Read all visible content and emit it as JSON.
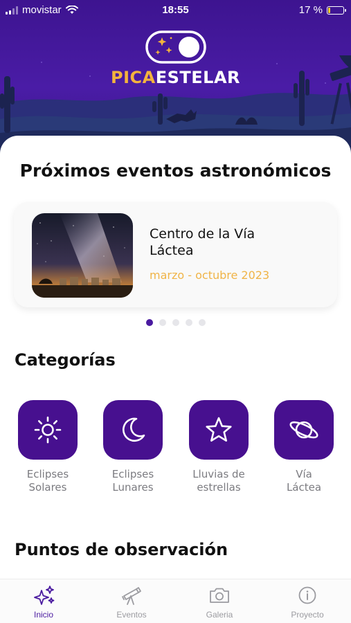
{
  "status_bar": {
    "carrier": "movistar",
    "time": "18:55",
    "battery_percent_text": "17 %",
    "battery_level": 0.17
  },
  "logo": {
    "part1": "PICA",
    "part2": "ESTELAR",
    "colors": {
      "part1": "#f3b33d",
      "part2": "#ffffff",
      "background": "#3d1490"
    }
  },
  "events_section": {
    "title": "Próximos eventos astronómicos",
    "cards": [
      {
        "name": "Centro de la Vía Láctea",
        "date": "marzo - octubre 2023",
        "image": "milky-way-photo"
      }
    ],
    "page_count": 5,
    "active_page": 0
  },
  "categories_section": {
    "title": "Categorías",
    "items": [
      {
        "label1": "Eclipses",
        "label2": "Solares",
        "icon": "sun-icon"
      },
      {
        "label1": "Eclipses",
        "label2": "Lunares",
        "icon": "moon-icon"
      },
      {
        "label1": "Lluvias de",
        "label2": "estrellas",
        "icon": "star-icon"
      },
      {
        "label1": "Vía",
        "label2": "Láctea",
        "icon": "planet-icon"
      }
    ],
    "tile_color": "#47108f"
  },
  "observation_section": {
    "title": "Puntos de observación"
  },
  "tabbar": {
    "tabs": [
      {
        "label": "Inicio",
        "icon": "sparkles-icon",
        "active": true
      },
      {
        "label": "Eventos",
        "icon": "telescope-icon",
        "active": false
      },
      {
        "label": "Galeria",
        "icon": "camera-icon",
        "active": false
      },
      {
        "label": "Proyecto",
        "icon": "info-icon",
        "active": false
      }
    ],
    "active_color": "#4a1aa0"
  }
}
